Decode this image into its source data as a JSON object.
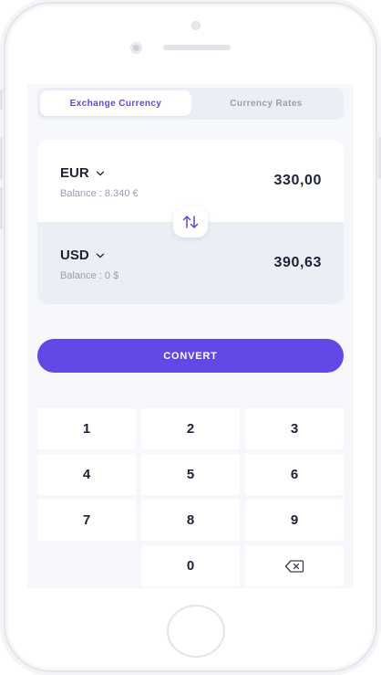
{
  "tabs": [
    {
      "label": "Exchange Currency",
      "active": true
    },
    {
      "label": "Currency Rates",
      "active": false
    }
  ],
  "exchange": {
    "from": {
      "currency": "EUR",
      "balance": "Balance : 8.340 €",
      "amount": "330,00"
    },
    "to": {
      "currency": "USD",
      "balance": "Balance : 0 $",
      "amount": "390,63"
    },
    "swap_icon": "swap-arrows-icon"
  },
  "convert_label": "CONVERT",
  "keypad": {
    "keys": [
      "1",
      "2",
      "3",
      "4",
      "5",
      "6",
      "7",
      "8",
      "9",
      "",
      "0",
      "backspace-icon"
    ]
  },
  "colors": {
    "accent": "#6248e6",
    "card_bottom": "#eceef6",
    "muted_text": "#9a9db0"
  }
}
